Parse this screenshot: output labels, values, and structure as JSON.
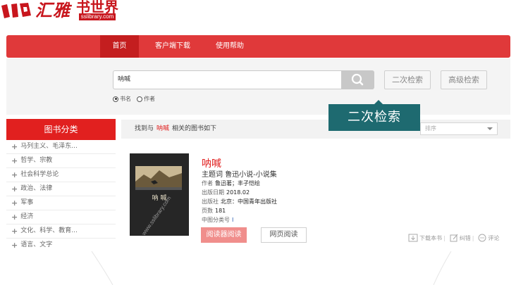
{
  "logo": {
    "brand_cn": "汇雅",
    "subtitle_cn": "书世界",
    "url": "sslibrary.com"
  },
  "nav": {
    "home": "首页",
    "client_download": "客户端下载",
    "help": "使用帮助"
  },
  "search": {
    "query": "呐喊",
    "second_search_label": "二次检索",
    "advanced_search_label": "高级检索",
    "radio_title": "书名",
    "radio_author": "作者",
    "selected_radio": "书名"
  },
  "tooltip": {
    "text": "二次检索"
  },
  "sidebar": {
    "header": "图书分类",
    "items": [
      {
        "label": "马列主义、毛泽东..."
      },
      {
        "label": "哲学、宗教"
      },
      {
        "label": "社会科学总论"
      },
      {
        "label": "政治、法律"
      },
      {
        "label": "军事"
      },
      {
        "label": "经济"
      },
      {
        "label": "文化、科学、教育..."
      },
      {
        "label": "语言、文字"
      }
    ]
  },
  "results": {
    "prefix": "找到与",
    "keyword": "呐喊",
    "suffix": "相关的图书如下",
    "sort_label": "排序"
  },
  "book": {
    "title": "呐喊",
    "subject_label": "主题词",
    "subject_value": "鲁迅小说-小说集",
    "author_label": "作者",
    "author_value": "鲁迅著；丰子恺绘",
    "date_label": "出版日期",
    "date_value": "2018.02",
    "publisher_label": "出版社",
    "publisher_value": "北京：中国青年出版社",
    "pages_label": "页数",
    "pages_value": "181",
    "clc_label": "中图分类号",
    "clc_value": "I",
    "cover_title": "呐 喊",
    "cover_watermark": "www.sslibrary.com",
    "reader_button": "阅读器阅读",
    "web_button": "网页阅读",
    "download_label": "下载本书",
    "report_label": "纠错",
    "comment_label": "评论"
  },
  "colors": {
    "brand_red": "#e1201f",
    "nav_red": "#e0393a",
    "tooltip_teal": "#1e6a70"
  }
}
